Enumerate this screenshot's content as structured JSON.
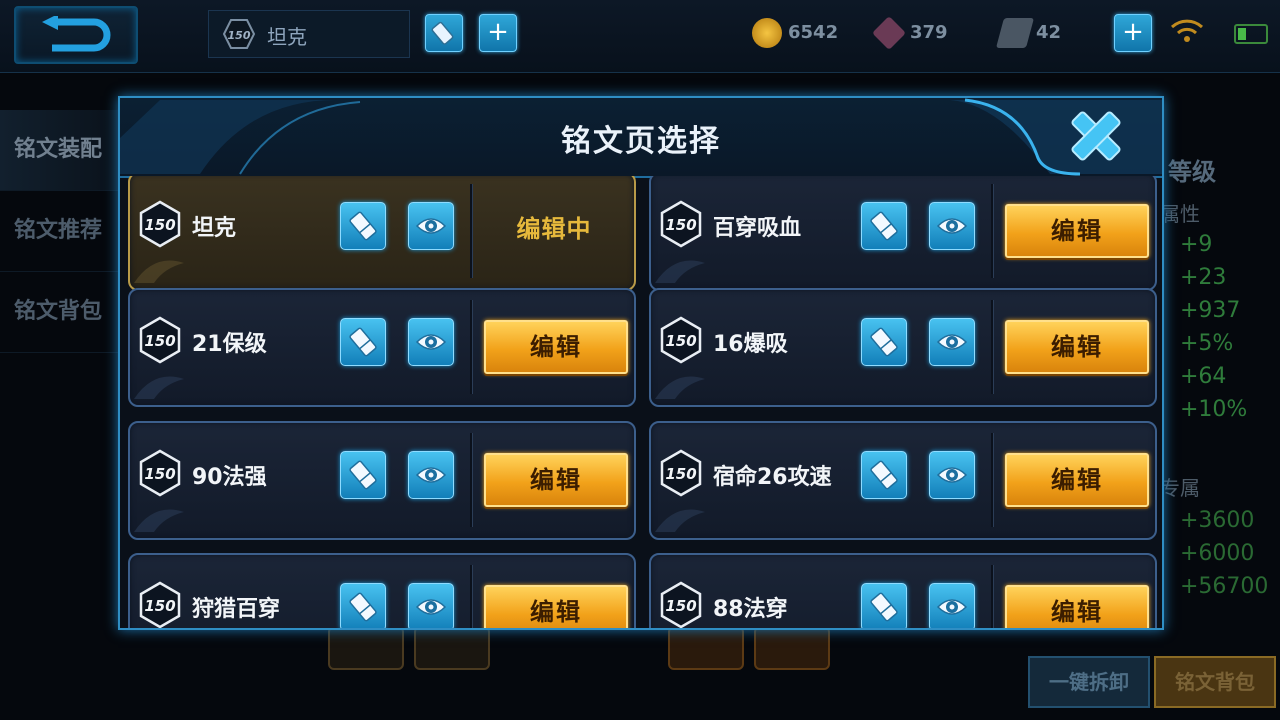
{
  "header": {
    "hero_level": "150",
    "hero_name": "坦克",
    "resources": [
      {
        "icon": "gold-coin-icon",
        "value": "6542",
        "color": "#e0a020"
      },
      {
        "icon": "diamond-icon",
        "value": "379",
        "color": "#b06a8a"
      },
      {
        "icon": "ticket-icon",
        "value": "42",
        "color": "#8aa0b0"
      }
    ]
  },
  "sidebar": {
    "items": [
      {
        "label": "铭文装配"
      },
      {
        "label": "铭文推荐"
      },
      {
        "label": "铭文背包"
      }
    ]
  },
  "right_panel": {
    "title": "等级",
    "attr_label": "属性",
    "stats": [
      "+9",
      "+23",
      "+937",
      "+5%",
      "+64",
      "+10%"
    ],
    "exclusive_label": "专属",
    "exclusive_stats": [
      "+3600",
      "+6000",
      "+56700"
    ]
  },
  "bottom": {
    "unequip_all": "一键拆卸",
    "rune_bag": "铭文背包"
  },
  "modal": {
    "title": "铭文页选择",
    "edit_label": "编辑",
    "editing_label": "编辑中",
    "pages": [
      {
        "level": "150",
        "name": "坦克",
        "active": true
      },
      {
        "level": "150",
        "name": "百穿吸血",
        "active": false
      },
      {
        "level": "150",
        "name": "21保级",
        "active": false
      },
      {
        "level": "150",
        "name": "16爆吸",
        "active": false
      },
      {
        "level": "150",
        "name": "90法强",
        "active": false
      },
      {
        "level": "150",
        "name": "宿命26攻速",
        "active": false
      },
      {
        "level": "150",
        "name": "狩猎百穿",
        "active": false
      },
      {
        "level": "150",
        "name": "88法穿",
        "active": false
      }
    ]
  }
}
